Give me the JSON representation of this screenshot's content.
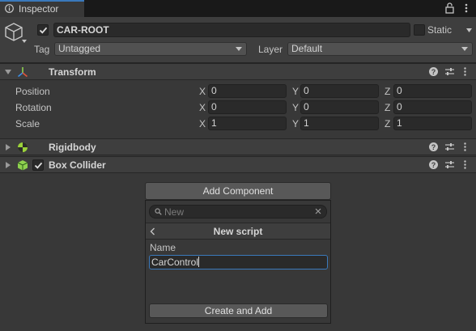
{
  "tab": {
    "label": "Inspector"
  },
  "gameobject": {
    "name": "CAR-ROOT",
    "active": true,
    "static_label": "Static",
    "static": false,
    "tag_label": "Tag",
    "tag_value": "Untagged",
    "layer_label": "Layer",
    "layer_value": "Default"
  },
  "transform": {
    "title": "Transform",
    "rows": [
      {
        "label": "Position",
        "x": "0",
        "y": "0",
        "z": "0"
      },
      {
        "label": "Rotation",
        "x": "0",
        "y": "0",
        "z": "0"
      },
      {
        "label": "Scale",
        "x": "1",
        "y": "1",
        "z": "1"
      }
    ],
    "axis": {
      "x": "X",
      "y": "Y",
      "z": "Z"
    }
  },
  "components": [
    {
      "title": "Rigidbody",
      "icon": "rigidbody-icon"
    },
    {
      "title": "Box Collider",
      "icon": "box-collider-icon",
      "enabled": true
    }
  ],
  "add_component": {
    "button_label": "Add Component",
    "search_placeholder": "New",
    "panel_title": "New script",
    "name_label": "Name",
    "script_name": "CarControl",
    "create_label": "Create and Add"
  },
  "colors": {
    "background": "#383838",
    "header": "#3e3e3e",
    "accent": "#3a79bb"
  }
}
